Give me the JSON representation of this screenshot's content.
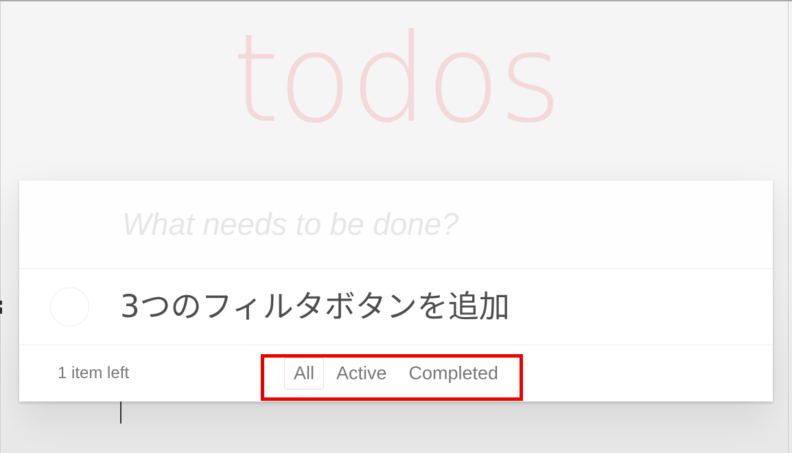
{
  "header": {
    "title": "todos",
    "title_color": "#f3d9d9"
  },
  "new_todo": {
    "placeholder": "What needs to be done?",
    "value": "",
    "caret_visible": true
  },
  "todos": [
    {
      "label": "3つのフィルタボタンを追加",
      "completed": false,
      "toggle_name": "toggle-todo-0"
    }
  ],
  "footer": {
    "count_text": "1 item left",
    "filters": [
      {
        "label": "All",
        "selected": true
      },
      {
        "label": "Active",
        "selected": false
      },
      {
        "label": "Completed",
        "selected": false
      }
    ]
  },
  "annotation": {
    "color": "#ee0000",
    "target": "filter-buttons"
  }
}
